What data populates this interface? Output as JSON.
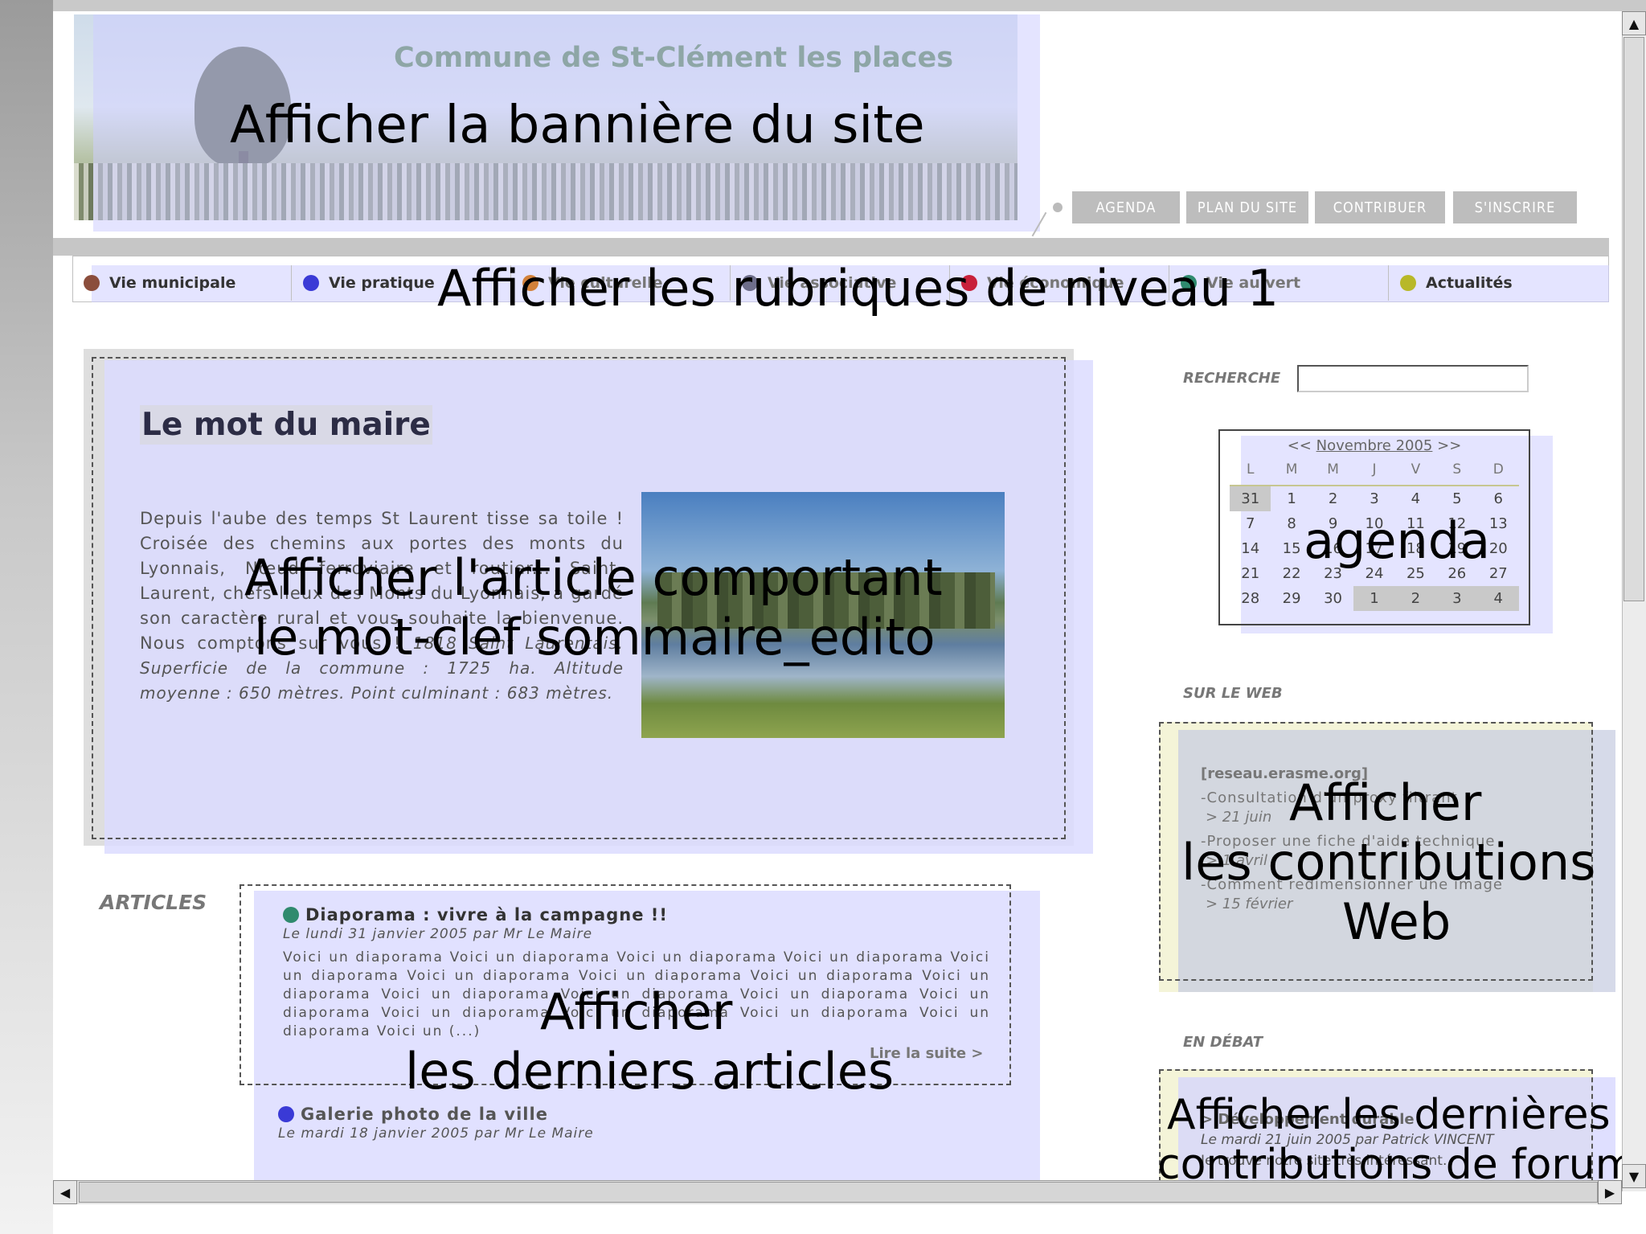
{
  "banner": {
    "site_title": "Commune de St-Clément les places",
    "annotation": "Afficher la bannière du site"
  },
  "top_nav": {
    "buttons": [
      "AGENDA",
      "PLAN DU SITE",
      "CONTRIBUER",
      "S'INSCRIRE"
    ]
  },
  "rubriques": {
    "items": [
      {
        "label": "Vie municipale",
        "color": "#8b4d3c"
      },
      {
        "label": "Vie pratique",
        "color": "#3a3ad6"
      },
      {
        "label": "Vie culturelle",
        "color": "#d2813a"
      },
      {
        "label": "Vie associative",
        "color": "#6d6d8a"
      },
      {
        "label": "Vie économique",
        "color": "#c8203a"
      },
      {
        "label": "Vie au vert",
        "color": "#2f8a6e"
      },
      {
        "label": "Actualités",
        "color": "#b8b828"
      }
    ],
    "annotation": "Afficher les rubriques de niveau 1"
  },
  "edito": {
    "title": "Le mot du maire",
    "body": "Depuis l'aube des temps St Laurent tisse sa toile ! Croisée des chemins aux portes des monts du Lyonnais, Nœud ferroviaire et routier... Saint-Laurent, chefs-lieux des Monts du Lyonnais, a gardé son caractère rural et vous souhaite la bienvenue. Nous comptons sur vous !",
    "body_italic": "1818 Saint Laurentais. Superficie de la commune : 1725 ha. Altitude moyenne : 650 mètres. Point culminant : 683 mètres.",
    "annotation_line1": "Afficher l'article comportant",
    "annotation_line2": "le mot-clef sommaire_edito"
  },
  "search": {
    "label": "RECHERCHE",
    "value": ""
  },
  "calendar": {
    "prev": "<<",
    "month": "Novembre 2005",
    "next": ">>",
    "days": [
      "L",
      "M",
      "M",
      "J",
      "V",
      "S",
      "D"
    ],
    "weeks": [
      [
        "31",
        "1",
        "2",
        "3",
        "4",
        "5",
        "6"
      ],
      [
        "7",
        "8",
        "9",
        "10",
        "11",
        "12",
        "13"
      ],
      [
        "14",
        "15",
        "16",
        "17",
        "18",
        "19",
        "20"
      ],
      [
        "21",
        "22",
        "23",
        "24",
        "25",
        "26",
        "27"
      ],
      [
        "28",
        "29",
        "30",
        "1",
        "2",
        "3",
        "4"
      ]
    ],
    "annotation": "agenda"
  },
  "web": {
    "section_label": "SUR LE WEB",
    "source": "[reseau.erasme.org]",
    "items": [
      {
        "title": "-Consultation d'un proxy filtrant",
        "date": "> 21 juin"
      },
      {
        "title": "-Proposer une fiche d'aide technique",
        "date": "> 1 avril"
      },
      {
        "title": "-Comment redimensionner une image",
        "date": "> 15 février"
      }
    ],
    "annotation_line1": "Afficher",
    "annotation_line2": "les contributions",
    "annotation_line3": "Web"
  },
  "articles": {
    "section_label": "ARTICLES",
    "items": [
      {
        "title": "Diaporama : vivre à la campagne !!",
        "meta": "Le lundi 31 janvier 2005 par Mr Le Maire",
        "excerpt": "Voici un diaporama Voici un diaporama Voici un diaporama Voici un diaporama Voici un diaporama Voici un diaporama Voici un diaporama Voici un diaporama Voici un diaporama Voici un diaporama Voici un diaporama Voici un diaporama Voici un diaporama Voici un diaporama Voici un diaporama Voici un diaporama Voici un diaporama Voici un (...)",
        "read_more": "Lire la suite >",
        "dot_color": "#2f8a6e"
      },
      {
        "title": "Galerie photo de la ville",
        "meta": "Le mardi 18 janvier 2005 par Mr Le Maire",
        "dot_color": "#3a3ad6"
      }
    ],
    "annotation_line1": "Afficher",
    "annotation_line2": "les derniers articles"
  },
  "debate": {
    "section_label": "EN DÉBAT",
    "item_title": "> Développement durable",
    "item_meta": "Le mardi 21 juin 2005 par Patrick VINCENT",
    "item_excerpt": "Je trouve notre site très intéressant.",
    "annotation_line1": "Afficher les dernières",
    "annotation_line2": "contributions de forum"
  }
}
